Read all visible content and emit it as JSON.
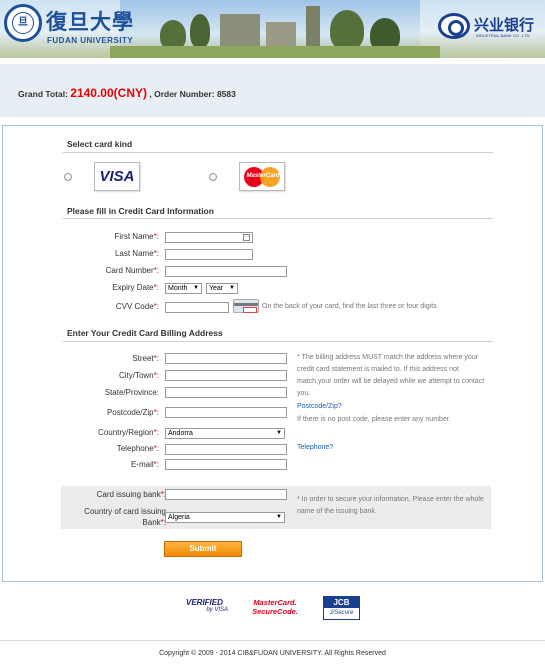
{
  "header": {
    "university_cn": "復旦大學",
    "university_en": "FUDAN UNIVERSITY",
    "bank_cn": "兴业银行",
    "bank_en": "INDUSTRIAL BANK CO., LTD."
  },
  "order": {
    "grand_total_label": "Grand Total:",
    "grand_total_value": "2140.00(CNY)",
    "order_number_label": ", Order Number:",
    "order_number_value": "8583"
  },
  "card_kind": {
    "title": "Select card kind",
    "options": [
      {
        "label": "VISA"
      },
      {
        "label": "MasterCard"
      }
    ]
  },
  "card_info": {
    "title": "Please fill in Credit Card Information",
    "first_name_label": "First Name",
    "last_name_label": "Last Name",
    "card_number_label": "Card Number",
    "expiry_label": "Expiry Date",
    "month_select": "Month",
    "year_select": "Year",
    "cvv_label": "CVV Code",
    "cvv_hint": "On the back of your card, find the last three or four digits",
    "required_mark": "*",
    "colon": ":"
  },
  "billing": {
    "title": "Enter Your Credit Card Billing Address",
    "street_label": "Street",
    "city_label": "City/Town",
    "state_label": "State/Province",
    "postcode_label": "Postcode/Zip",
    "country_label": "Country/Region",
    "country_value": "Andorra",
    "telephone_label": "Telephone",
    "email_label": "E-mail",
    "note_1": "* The billing address MUST match the address where your",
    "note_2": "credit card statement is mailed to. If this address not",
    "note_3": "match,your order will be delayed while we attempt to contact",
    "note_4": "you.",
    "postcode_link": "Postcode/Zip?",
    "postcode_hint": "If there is no post code, please enter any number.",
    "telephone_link": "Telephone?"
  },
  "bank": {
    "issuing_bank_label": "Card issuing bank",
    "issuing_country_label_1": "Country of card issuing",
    "issuing_country_label_2": "Bank",
    "issuing_country_value": "Algeria",
    "note_1": "* In order to secure your information, Please enter the whole",
    "note_2": "name of the issuing bank."
  },
  "submit_label": "Submit",
  "trust": {
    "vbv_line1": "VERIFIED",
    "vbv_line2": "by VISA",
    "mcsc_line1": "MasterCard.",
    "mcsc_line2": "SecureCode.",
    "jcb_line1": "JCB",
    "jcb_line2": "J/Secure"
  },
  "footer": {
    "copyright": "Copyright © 2009 - 2014 CIB&FUDAN UNIVERSITY. All Rights Reserved"
  },
  "colors": {
    "amount_red": "#e60000",
    "summary_bg": "#e8eff4",
    "submit_orange": "#f08a00",
    "link_blue": "#1a5fb4"
  }
}
